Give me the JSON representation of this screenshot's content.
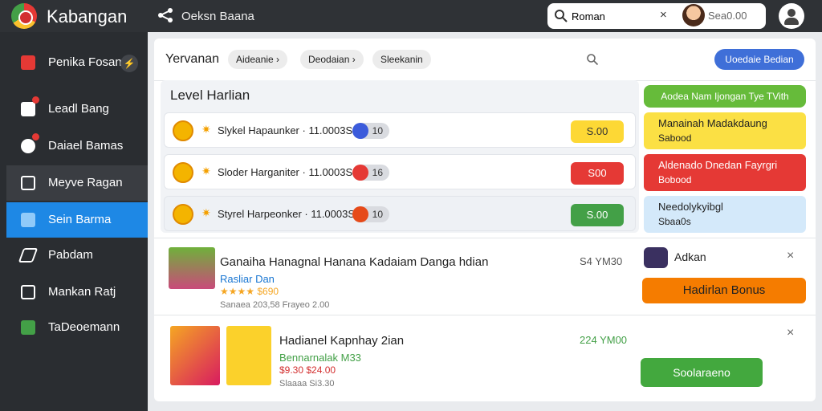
{
  "app": {
    "title": "Kabangan",
    "share_label": "Oeksn Baana"
  },
  "search": {
    "value": "Roman",
    "placeholder": "",
    "clear": "×",
    "user_value": "Sea0.00"
  },
  "sidebar": {
    "items": [
      {
        "label": "Penika Fosan",
        "icon": "chart-arrow-icon",
        "badge": ""
      },
      {
        "label": "Leadl Bang",
        "icon": "document-icon"
      },
      {
        "label": "Daiael Bamas",
        "icon": "camera-icon"
      },
      {
        "label": "Meyve Ragan",
        "icon": "folder-icon"
      },
      {
        "label": "Sein Barma",
        "icon": "tag-icon"
      },
      {
        "label": "Pabdam",
        "icon": "rocket-icon"
      },
      {
        "label": "Mankan Ratj",
        "icon": "calendar-icon"
      },
      {
        "label": "TaDeoemann",
        "icon": "chat-icon"
      }
    ]
  },
  "toolbar": {
    "title": "Yervanan",
    "breadcrumbs": [
      "Aideanie",
      "Deodaian",
      "Sleekanin"
    ],
    "primary_button": "Uoedaie Bedian"
  },
  "levels": {
    "title": "Level Harlian",
    "rows": [
      {
        "text": "Slykel Hapaunker · 11.0003S",
        "toggle": "10",
        "price": "S.00",
        "color": "#fdd835"
      },
      {
        "text": "Sloder Harganiter · 11.0003S",
        "toggle": "16",
        "price": "S00",
        "color": "#e53935"
      },
      {
        "text": "Styrel Harpeonker · 11.0003S",
        "toggle": "10",
        "price": "S.00",
        "color": "#43a047"
      }
    ]
  },
  "side_cards": {
    "green_label": "Aodea Nam Ijongan Tye TVith",
    "cards": [
      {
        "title": "Manainah Madakdaung",
        "sub": "Sabood",
        "color": "#fbe044"
      },
      {
        "title": "Aldenado Dnedan Fayrgri",
        "sub": "Bobood",
        "color": "#e53935"
      },
      {
        "title": "Needolykyibgl",
        "sub": "Sbaa0s",
        "color": "#d4e9fa"
      }
    ]
  },
  "products": [
    {
      "name": "Ganaiha Hanagnal Hanana Kadaiam Danga hdian",
      "sub": "Rasliar Dan",
      "stars": "★★★★ $690",
      "meta": "Sanaea 203,58 Frayeo 2.00",
      "price": "S4 YM30"
    },
    {
      "name": "Hadianel Kapnhay 2ian",
      "sub": "Bennarnalak M33",
      "stars": "$9.30  $24.00",
      "meta": "Slaaaa Si3.30",
      "price": "224 YM00"
    }
  ],
  "actions": {
    "adkan": "Adkan",
    "bonus": "Hadirlan Bonus",
    "green": "Soolaraeno",
    "close": "×"
  }
}
